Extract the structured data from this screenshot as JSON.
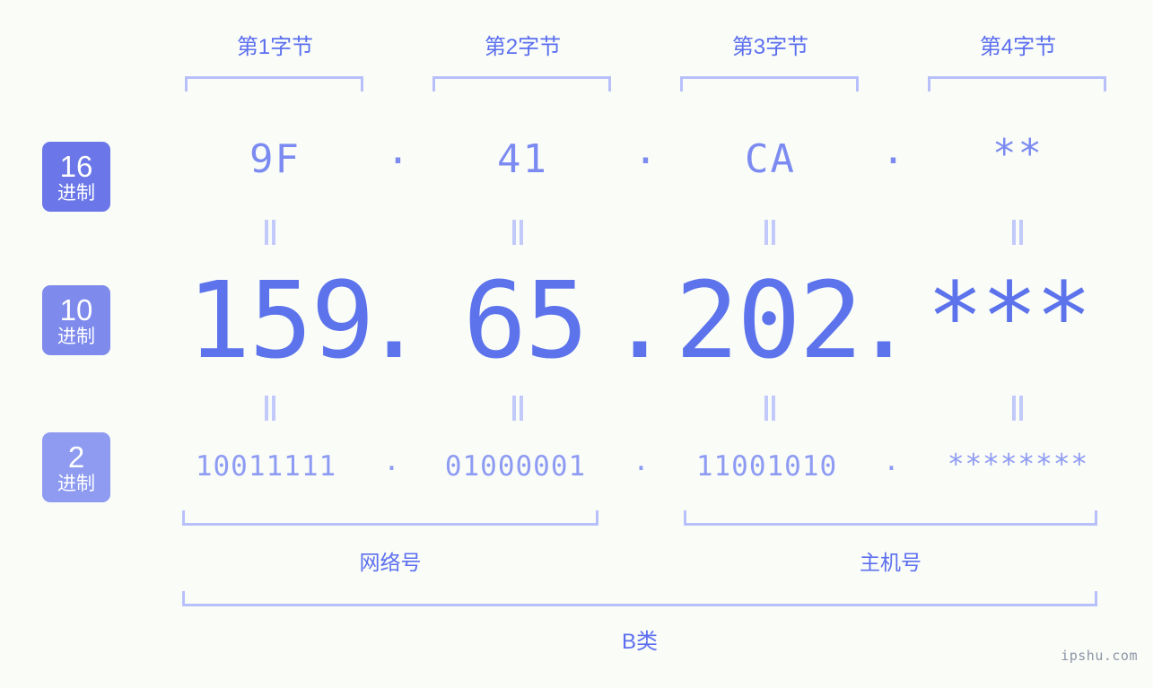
{
  "background_color": "#fafdf7",
  "accent_color": "#5c6ef0",
  "bracket_color": "#b8c0fb",
  "byte_headers": [
    {
      "label": "第1字节"
    },
    {
      "label": "第2字节"
    },
    {
      "label": "第3字节"
    },
    {
      "label": "第4字节"
    }
  ],
  "bases": [
    {
      "num": "16",
      "zh": "进制",
      "color": "#6b77e8"
    },
    {
      "num": "10",
      "zh": "进制",
      "color": "#7e8aec"
    },
    {
      "num": "2",
      "zh": "进制",
      "color": "#8e9bf0"
    }
  ],
  "separator": ".",
  "rows": {
    "hex": {
      "base": "16",
      "values": [
        "9F",
        "41",
        "CA",
        "**"
      ]
    },
    "decimal": {
      "base": "10",
      "values": [
        "159",
        "65",
        "202",
        "***"
      ]
    },
    "binary": {
      "base": "2",
      "values": [
        "10011111",
        "01000001",
        "11001010",
        "********"
      ]
    }
  },
  "equals_symbol": "=",
  "sections": [
    {
      "label": "网络号"
    },
    {
      "label": "主机号"
    }
  ],
  "ip_class": "B类",
  "watermark": "ipshu.com"
}
